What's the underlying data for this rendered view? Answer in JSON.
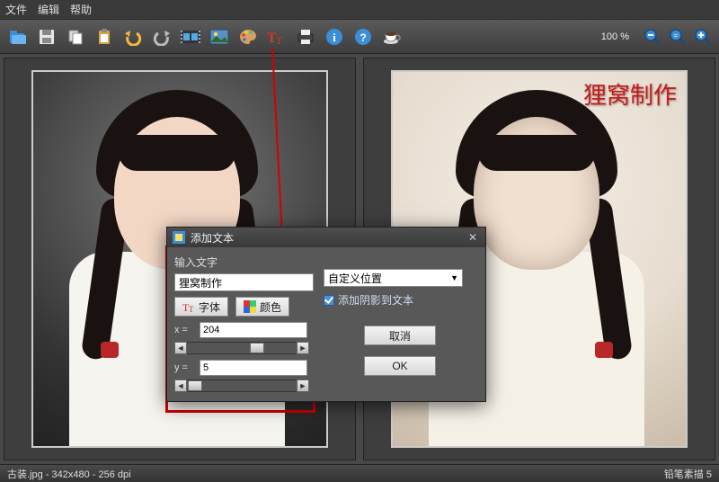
{
  "menu": {
    "file": "文件",
    "edit": "编辑",
    "help": "帮助"
  },
  "toolbar": {
    "zoom_label": "100 %",
    "icons": {
      "open": "open-folder-icon",
      "save": "save-icon",
      "copy": "copy-icon",
      "paste": "paste-icon",
      "undo": "undo-icon",
      "redo": "redo-icon",
      "film": "film-icon",
      "image-adjust": "image-adjust-icon",
      "palette": "palette-icon",
      "text": "text-icon",
      "print": "print-icon",
      "info": "info-icon",
      "help": "help-icon",
      "coffee": "coffee-icon"
    }
  },
  "watermark_text": "狸窝制作",
  "status": {
    "left": "古装.jpg - 342x480 - 256 dpi",
    "right": "铅笔素描 5"
  },
  "dialog": {
    "title": "添加文本",
    "input_label": "输入文字",
    "text_value": "狸窝制作",
    "font_btn": "字体",
    "color_btn": "颜色",
    "position_select": "自定义位置",
    "shadow_check": "添加阴影到文本",
    "x_label": "x =",
    "x_value": "204",
    "y_label": "y =",
    "y_value": "5",
    "cancel": "取消",
    "ok": "OK"
  }
}
